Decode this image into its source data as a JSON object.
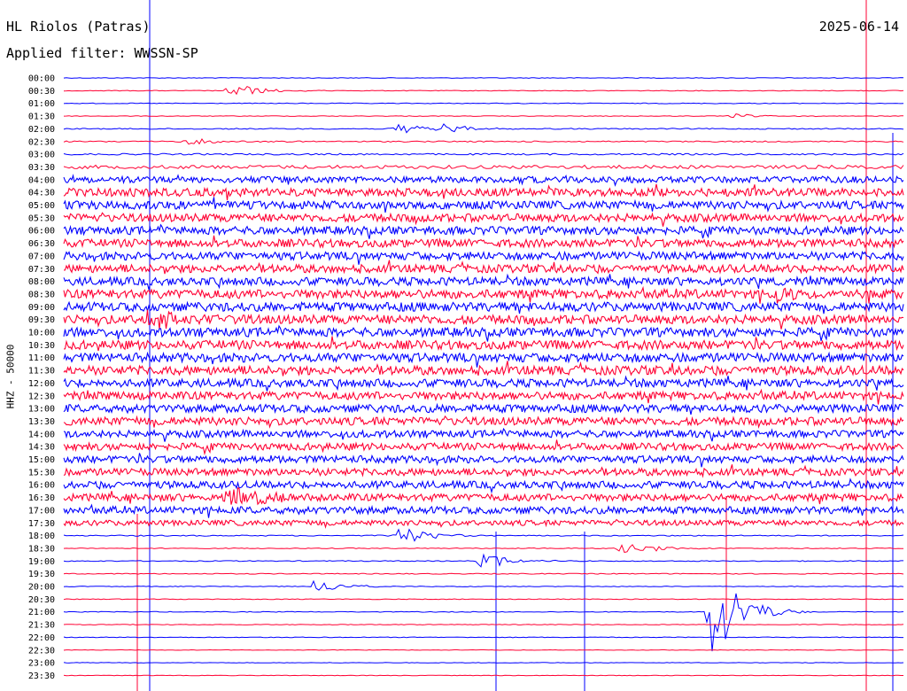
{
  "header": {
    "station": "HL Riolos (Patras)",
    "date": "2025-06-14",
    "filter": "Applied filter: WWSSN-SP"
  },
  "chart_data": {
    "type": "line",
    "title": "HL Riolos (Patras)",
    "date": "2025-06-14",
    "subtitle": "Applied filter: WWSSN-SP",
    "ylabel": "HHZ - 50000",
    "colors": [
      "#0000ff",
      "#ff0033"
    ],
    "row_labels": [
      "00:00",
      "00:30",
      "01:00",
      "01:30",
      "02:00",
      "02:30",
      "03:00",
      "03:30",
      "04:00",
      "04:30",
      "05:00",
      "05:30",
      "06:00",
      "06:30",
      "07:00",
      "07:30",
      "08:00",
      "08:30",
      "09:00",
      "09:30",
      "10:00",
      "10:30",
      "11:00",
      "11:30",
      "12:00",
      "12:30",
      "13:00",
      "13:30",
      "14:00",
      "14:30",
      "15:00",
      "15:30",
      "16:00",
      "16:30",
      "17:00",
      "17:30",
      "18:00",
      "18:30",
      "19:00",
      "19:30",
      "20:00",
      "20:30",
      "21:00",
      "21:30",
      "22:00",
      "22:30",
      "23:00",
      "23:30"
    ],
    "noise_level": [
      0.4,
      0.4,
      0.4,
      0.4,
      0.6,
      0.7,
      0.9,
      2.0,
      3.5,
      4.5,
      4.5,
      4.5,
      4.5,
      4.5,
      4.5,
      4.5,
      4.5,
      5.0,
      5.0,
      5.0,
      5.0,
      5.0,
      5.0,
      5.0,
      4.5,
      4.5,
      4.5,
      4.5,
      4.0,
      4.0,
      4.0,
      4.0,
      4.0,
      4.0,
      4.0,
      3.0,
      0.6,
      0.5,
      0.5,
      0.5,
      0.4,
      0.4,
      0.4,
      0.4,
      0.4,
      0.3,
      0.3,
      0.3
    ],
    "events": [
      {
        "row": 1,
        "minute": 6.0,
        "amp": 9
      },
      {
        "row": 3,
        "minute": 24.0,
        "amp": 3
      },
      {
        "row": 4,
        "minute": 12.0,
        "amp": 7
      },
      {
        "row": 4,
        "minute": 13.5,
        "amp": 6
      },
      {
        "row": 5,
        "minute": 4.5,
        "amp": 4
      },
      {
        "row": 17,
        "minute": 25.5,
        "amp": 9
      },
      {
        "row": 19,
        "minute": 3.0,
        "amp": 12
      },
      {
        "row": 33,
        "minute": 6.0,
        "amp": 14
      },
      {
        "row": 36,
        "minute": 12.0,
        "amp": 12
      },
      {
        "row": 37,
        "minute": 20.0,
        "amp": 10
      },
      {
        "row": 38,
        "minute": 15.0,
        "amp": 9
      },
      {
        "row": 40,
        "minute": 9.0,
        "amp": 8
      },
      {
        "row": 42,
        "minute": 23.2,
        "amp": 60
      }
    ]
  }
}
